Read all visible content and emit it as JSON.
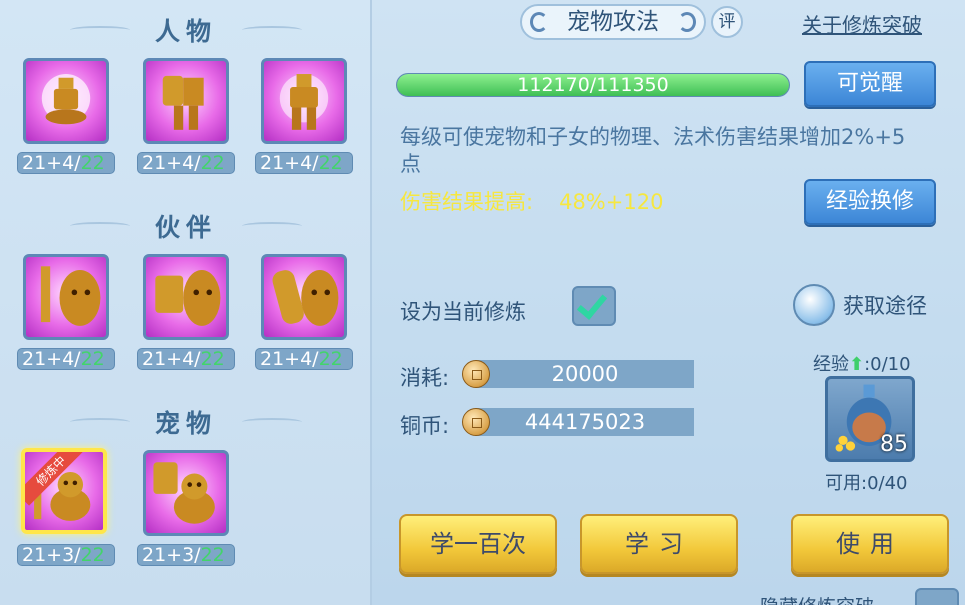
{
  "categories": {
    "character": {
      "title": "人物",
      "slots": [
        {
          "icon": "meditating-armor-icon",
          "level": "21+4/",
          "max": "22"
        },
        {
          "icon": "shield-armor-icon",
          "level": "21+4/",
          "max": "22"
        },
        {
          "icon": "standing-armor-icon",
          "level": "21+4/",
          "max": "22"
        }
      ]
    },
    "partner": {
      "title": "伙伴",
      "slots": [
        {
          "icon": "sword-beast-icon",
          "level": "21+4/",
          "max": "22"
        },
        {
          "icon": "shield-beast-icon",
          "level": "21+4/",
          "max": "22"
        },
        {
          "icon": "gauntlet-beast-icon",
          "level": "21+4/",
          "max": "22"
        }
      ]
    },
    "pet": {
      "title": "宠物",
      "training_badge": "修炼中",
      "slots": [
        {
          "icon": "cat-attack-icon",
          "level": "21+3/",
          "max": "22"
        },
        {
          "icon": "cat-shield-icon",
          "level": "21+3/",
          "max": "22"
        }
      ]
    }
  },
  "detail": {
    "title": "宠物攻法",
    "eval_badge": "评",
    "about_link": "关于修炼突破",
    "progress_text": "112170/111350",
    "progress_fraction": 1.0,
    "awaken_button": "可觉醒",
    "description": "每级可使宠物和子女的物理、法术伤害结果增加2%+5点",
    "effect_label": "伤害结果提高:",
    "effect_value": "48%+120",
    "exchange_button": "经验换修",
    "set_current_label": "设为当前修炼",
    "set_current_checked": true,
    "obtain_label": "获取途径",
    "cost_label": "消耗:",
    "cost_value": "20000",
    "coin_label": "铜币:",
    "coin_value": "444175023",
    "exp_label": "经验",
    "exp_value": ":0/10",
    "item_icon": "exp-potion-icon",
    "item_count": "85",
    "avail_label": "可用:0/40",
    "learn_hundred_button": "学一百次",
    "learn_button": "学习",
    "use_button": "使用",
    "hidden_label": "隐藏修炼突破"
  },
  "colors": {
    "background": "#c8ddef",
    "max_level": "#43d46b",
    "effect_text": "#f6e740",
    "button_blue": "#3c86d6",
    "button_gold": "#f2c83a",
    "slot_purple": "#e86be8"
  }
}
